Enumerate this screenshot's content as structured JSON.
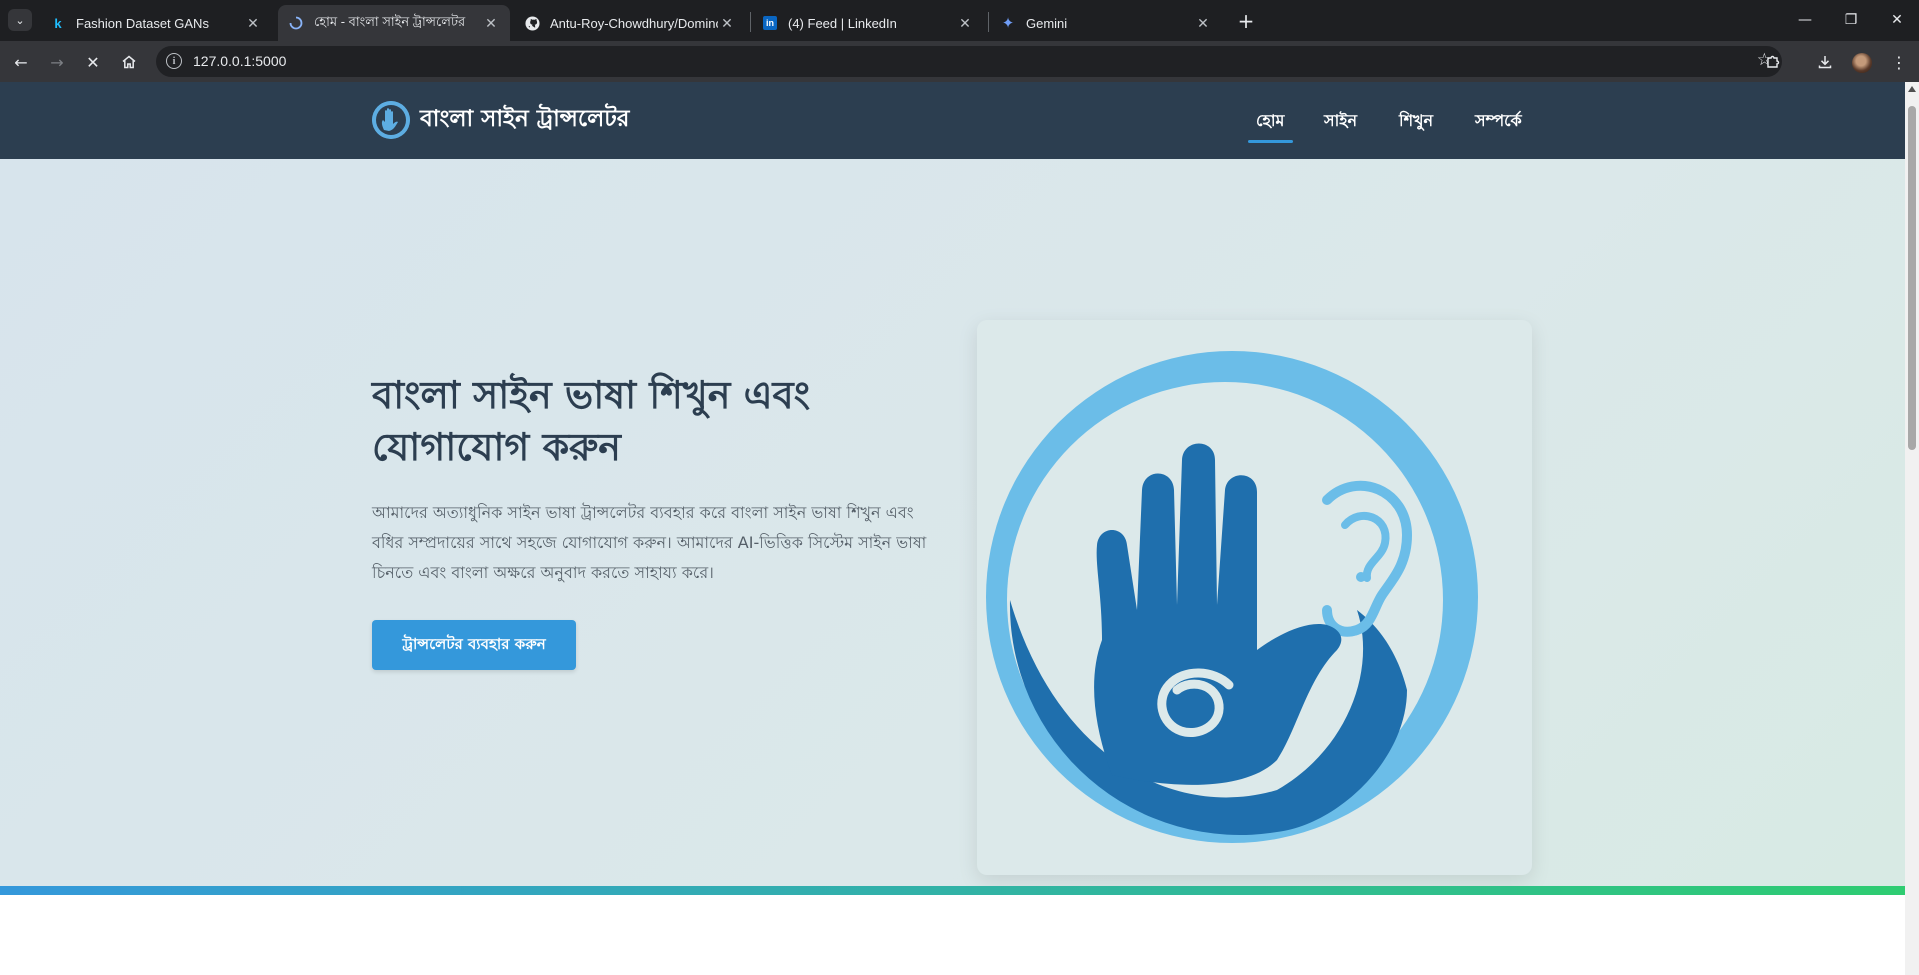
{
  "browser": {
    "tabs": [
      {
        "title": "Fashion Dataset GANs",
        "favicon": "kaggle-k"
      },
      {
        "title": "হোম - বাংলা সাইন ট্রান্সলেটর",
        "favicon": "loading-spinner"
      },
      {
        "title": "Antu-Roy-Chowdhury/Dominoes",
        "favicon": "github"
      },
      {
        "title": "(4) Feed | LinkedIn",
        "favicon": "linkedin"
      },
      {
        "title": "Gemini",
        "favicon": "gemini-star"
      }
    ],
    "url": "127.0.0.1:5000"
  },
  "site": {
    "brand": "বাংলা সাইন ট্রান্সলেটর",
    "nav": [
      {
        "label": "হোম",
        "active": true
      },
      {
        "label": "সাইন",
        "active": false
      },
      {
        "label": "শিখুন",
        "active": false
      },
      {
        "label": "সম্পর্কে",
        "active": false
      }
    ]
  },
  "hero": {
    "title": "বাংলা সাইন ভাষা শিখুন এবং যোগাযোগ করুন",
    "description": "আমাদের অত্যাধুনিক সাইন ভাষা ট্রান্সলেটর ব্যবহার করে বাংলা সাইন ভাষা শিখুন এবং বধির সম্প্রদায়ের সাথে সহজে যোগাযোগ করুন। আমাদের AI-ভিত্তিক সিস্টেম সাইন ভাষা চিনতে এবং বাংলা অক্ষরে অনুবাদ করতে সাহায্য করে।",
    "cta_label": "ট্রান্সলেটর ব্যবহার করুন"
  },
  "colors": {
    "header_bg": "#2c3e50",
    "accent": "#3498db",
    "accent_end": "#2ecc71",
    "logo_light": "#5dade2",
    "logo_dark": "#1f6fad"
  }
}
